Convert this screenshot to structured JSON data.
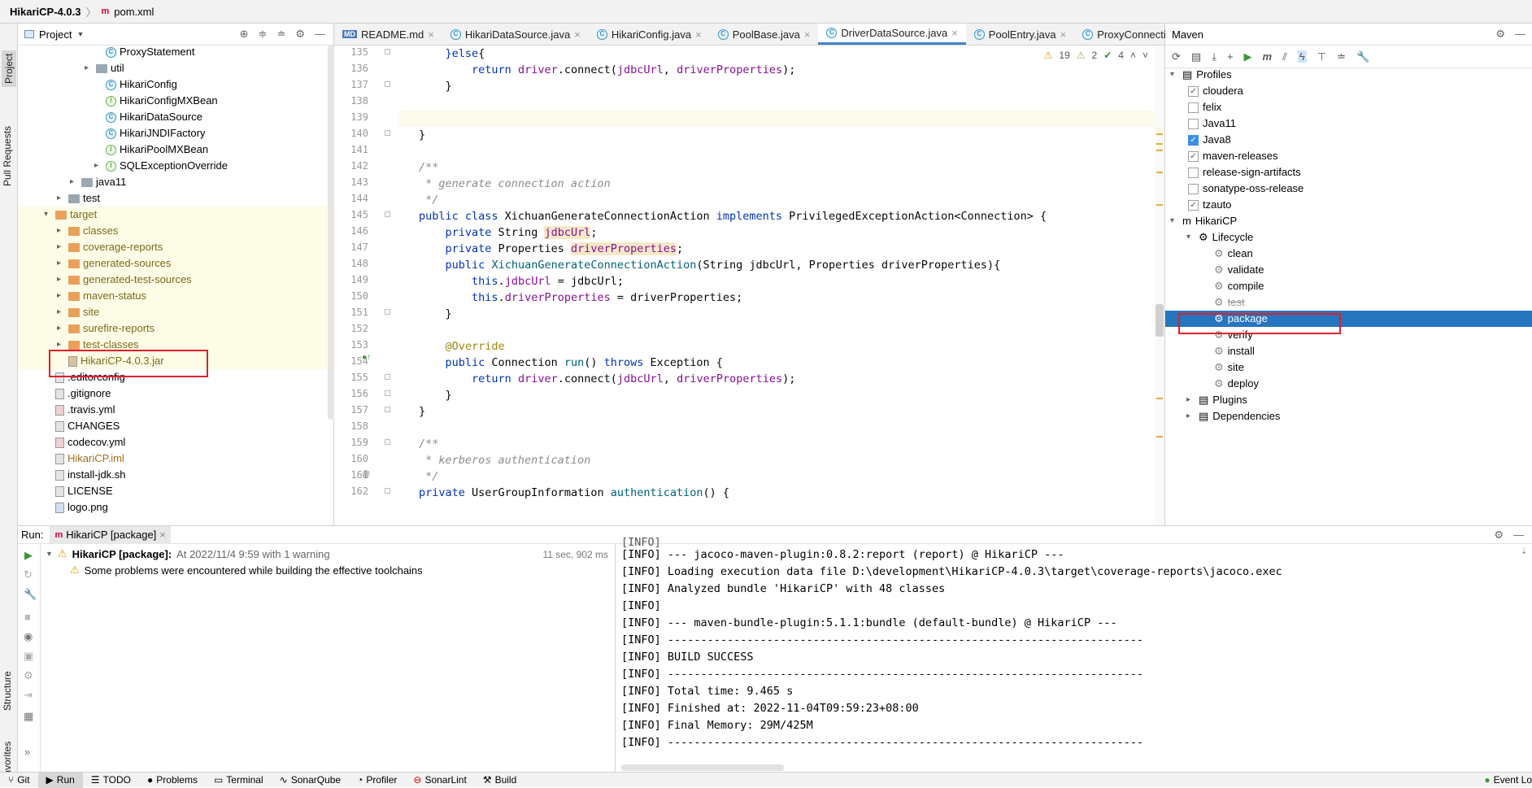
{
  "title": {
    "project": "HikariCP-4.0.3",
    "file": "pom.xml"
  },
  "left_strip": {
    "project": "Project",
    "pull_requests": "Pull Requests",
    "structure": "Structure",
    "favorites": "Favorites"
  },
  "project_panel": {
    "header": "Project",
    "items": [
      {
        "label": "ProxyStatement",
        "icon": "class-icon"
      },
      {
        "label": "util",
        "icon": "folder-icon"
      },
      {
        "label": "HikariConfig",
        "icon": "class-icon"
      },
      {
        "label": "HikariConfigMXBean",
        "icon": "interface-icon"
      },
      {
        "label": "HikariDataSource",
        "icon": "class-icon"
      },
      {
        "label": "HikariJNDIFactory",
        "icon": "class-icon"
      },
      {
        "label": "HikariPoolMXBean",
        "icon": "interface-icon"
      },
      {
        "label": "SQLExceptionOverride",
        "icon": "interface-icon"
      },
      {
        "label": "java11",
        "icon": "folder-icon"
      },
      {
        "label": "test",
        "icon": "folder-icon"
      },
      {
        "label": "target",
        "icon": "folder-icon"
      },
      {
        "label": "classes",
        "icon": "folder-icon"
      },
      {
        "label": "coverage-reports",
        "icon": "folder-icon"
      },
      {
        "label": "generated-sources",
        "icon": "folder-icon"
      },
      {
        "label": "generated-test-sources",
        "icon": "folder-icon"
      },
      {
        "label": "maven-status",
        "icon": "folder-icon"
      },
      {
        "label": "site",
        "icon": "folder-icon"
      },
      {
        "label": "surefire-reports",
        "icon": "folder-icon"
      },
      {
        "label": "test-classes",
        "icon": "folder-icon"
      },
      {
        "label": "HikariCP-4.0.3.jar",
        "icon": "jar-icon"
      },
      {
        "label": ".editorconfig",
        "icon": "file-icon"
      },
      {
        "label": ".gitignore",
        "icon": "file-icon"
      },
      {
        "label": ".travis.yml",
        "icon": "yml-icon"
      },
      {
        "label": "CHANGES",
        "icon": "file-icon"
      },
      {
        "label": "codecov.yml",
        "icon": "yml-icon"
      },
      {
        "label": "HikariCP.iml",
        "icon": "iml-icon"
      },
      {
        "label": "install-jdk.sh",
        "icon": "file-icon"
      },
      {
        "label": "LICENSE",
        "icon": "file-icon"
      },
      {
        "label": "logo.png",
        "icon": "image-icon"
      }
    ]
  },
  "editor": {
    "tabs": [
      "README.md",
      "HikariDataSource.java",
      "HikariConfig.java",
      "PoolBase.java",
      "DriverDataSource.java",
      "PoolEntry.java",
      "ProxyConnecti"
    ],
    "active_tab": "DriverDataSource.java",
    "inspections": {
      "warnings": "19",
      "weak": "2",
      "ok": "4"
    },
    "line_numbers": [
      "135",
      "136",
      "137",
      "138",
      "139",
      "140",
      "141",
      "142",
      "143",
      "144",
      "145",
      "146",
      "147",
      "148",
      "149",
      "150",
      "151",
      "152",
      "153",
      "154",
      "155",
      "156",
      "157",
      "158",
      "159",
      "160",
      "161",
      "162"
    ]
  },
  "maven": {
    "header": "Maven",
    "profiles_label": "Profiles",
    "profiles": [
      {
        "label": "cloudera",
        "state": "grey-check"
      },
      {
        "label": "felix",
        "state": "off"
      },
      {
        "label": "Java11",
        "state": "off"
      },
      {
        "label": "Java8",
        "state": "on"
      },
      {
        "label": "maven-releases",
        "state": "grey-check"
      },
      {
        "label": "release-sign-artifacts",
        "state": "off"
      },
      {
        "label": "sonatype-oss-release",
        "state": "off"
      },
      {
        "label": "tzauto",
        "state": "grey-check"
      }
    ],
    "project": "HikariCP",
    "lifecycle_label": "Lifecycle",
    "lifecycle": [
      "clean",
      "validate",
      "compile",
      "test",
      "package",
      "verify",
      "install",
      "site",
      "deploy"
    ],
    "selected_phase": "package",
    "plugins": "Plugins",
    "dependencies": "Dependencies"
  },
  "run": {
    "label": "Run:",
    "tab": "HikariCP [package]",
    "tree_title": "HikariCP [package]:",
    "tree_time": "At 2022/11/4 9:59 with 1 warning",
    "duration": "11 sec, 902 ms",
    "warning": "Some problems were encountered while building the effective toolchains",
    "console": [
      "[INFO] --- jacoco-maven-plugin:0.8.2:report (report) @ HikariCP ---",
      "[INFO] Loading execution data file D:\\development\\HikariCP-4.0.3\\target\\coverage-reports\\jacoco.exec",
      "[INFO] Analyzed bundle 'HikariCP' with 48 classes",
      "[INFO]",
      "[INFO] --- maven-bundle-plugin:5.1.1:bundle (default-bundle) @ HikariCP ---",
      "[INFO] ------------------------------------------------------------------------",
      "[INFO] BUILD SUCCESS",
      "[INFO] ------------------------------------------------------------------------",
      "[INFO] Total time: 9.465 s",
      "[INFO] Finished at: 2022-11-04T09:59:23+08:00",
      "[INFO] Final Memory: 29M/425M",
      "[INFO] ------------------------------------------------------------------------"
    ]
  },
  "statusbar": [
    "Git",
    "Run",
    "TODO",
    "Problems",
    "Terminal",
    "SonarQube",
    "Profiler",
    "SonarLint",
    "Build",
    "Event Lo"
  ]
}
